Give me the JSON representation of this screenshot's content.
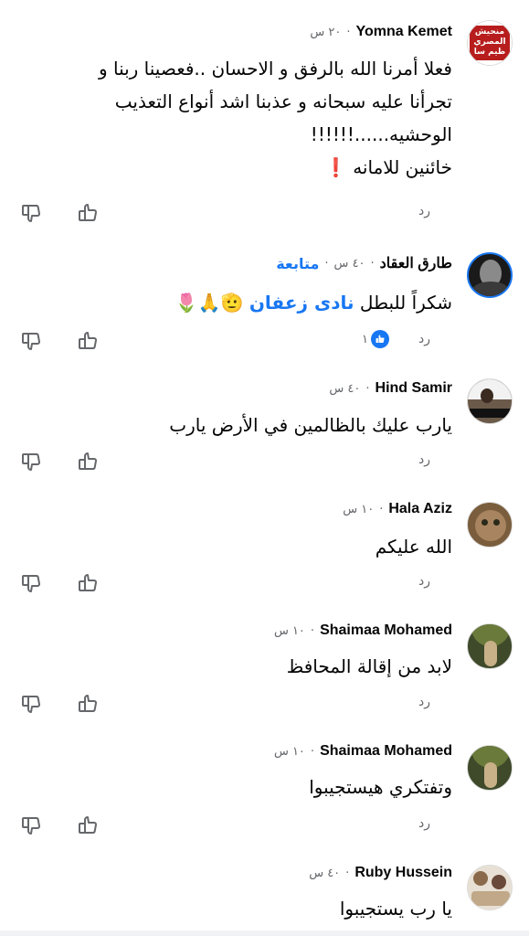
{
  "comments": [
    {
      "name": "Yomna Kemet",
      "time": "٢٠ س",
      "lines": [
        "فعلا أمرنا الله بالرفق و الاحسان ..فعصينا ربنا و",
        "تجرأنا عليه سبحانه و  عذبنا اشد أنواع التعذيب",
        "الوحشيه......!!!!!!",
        "خائنين للامانه ❗"
      ],
      "reply": "رد",
      "avatar_text": "منحيش المصري ظيم سا"
    },
    {
      "name": "طارق العقاد",
      "time": "٤٠ س",
      "follow": "متابعة",
      "text_before": "شكراً للبطل ",
      "mention": "نادى زعفان",
      "text_after": " 🫡🙏🌷",
      "reply": "رد",
      "reaction_count": "١"
    },
    {
      "name": "Hind Samir",
      "time": "٤٠ س",
      "text": "يارب عليك بالظالمين في الأرض يارب",
      "reply": "رد"
    },
    {
      "name": "Hala Aziz",
      "time": "١٠ س",
      "text": "الله عليكم",
      "reply": "رد"
    },
    {
      "name": "Shaimaa Mohamed",
      "time": "١٠ س",
      "text": "لابد من إقالة المحافظ",
      "reply": "رد"
    },
    {
      "name": "Shaimaa Mohamed",
      "time": "١٠ س",
      "text": "وتفتكري هيستجيبوا",
      "reply": "رد"
    },
    {
      "name": "Ruby Hussein",
      "time": "٤٠ س",
      "text": "يا رب يستجيبوا"
    }
  ],
  "colors": {
    "link": "#1877f2",
    "muted": "#65676b"
  }
}
